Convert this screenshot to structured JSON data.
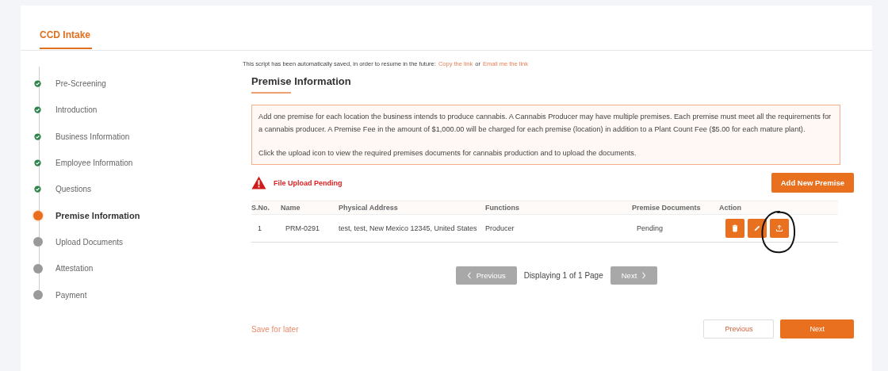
{
  "header": {
    "title": "CCD Intake"
  },
  "steps": [
    {
      "label": "Pre-Screening",
      "completed": true,
      "selected": false
    },
    {
      "label": "Introduction",
      "completed": true,
      "selected": false
    },
    {
      "label": "Business Information",
      "completed": true,
      "selected": false
    },
    {
      "label": "Employee Information",
      "completed": true,
      "selected": false
    },
    {
      "label": "Questions",
      "completed": true,
      "selected": false
    },
    {
      "label": "Premise Information",
      "completed": false,
      "selected": true
    },
    {
      "label": "Upload Documents",
      "completed": false,
      "selected": false
    },
    {
      "label": "Attestation",
      "completed": false,
      "selected": false
    },
    {
      "label": "Payment",
      "completed": false,
      "selected": false
    }
  ],
  "autosave": {
    "text": "This script has been automatically saved, in order to resume in the future:",
    "link_1": "Copy the link",
    "separator": "or",
    "link_2": "Email me the link"
  },
  "section_title": "Premise Information",
  "notice": [
    "Add one premise for each location the business intends to produce cannabis. A Cannabis Producer may have multiple premises. Each premise must meet all the requirements for a cannabis producer. A Premise Fee in the amount of $1,000.00 will be charged for each premise (location) in addition to a Plant Count Fee ($5.00 for each mature plant).",
    "Click the upload icon to view the required premises documents for cannabis production and to upload the documents."
  ],
  "warning": "File Upload Pending",
  "add_button": "Add New Premise",
  "table": {
    "columns": [
      "S.No.",
      "Name",
      "Physical Address",
      "Functions",
      "Premise Documents",
      "Action"
    ],
    "rows": [
      {
        "sno": "1",
        "name": "PRM-0291",
        "address": "test, test, New Mexico 12345, United States",
        "functions": "Producer",
        "documents": "Pending",
        "actions": [
          {
            "kind": "delete"
          },
          {
            "kind": "edit"
          },
          {
            "kind": "upload"
          }
        ]
      }
    ]
  },
  "pagination": {
    "previous": "Previous",
    "status": "Displaying 1 of 1 Page",
    "next": "Next",
    "previous_disabled": true,
    "next_disabled": true
  },
  "footer": {
    "save_later": "Save for later",
    "previous": "Previous",
    "next": "Next"
  },
  "annotation": {
    "kind": "circle"
  }
}
